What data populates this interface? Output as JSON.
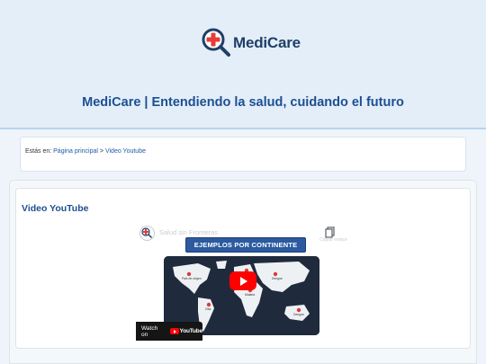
{
  "brand": {
    "name": "MediCare",
    "tagline": "MediCare | Entendiendo la salud, cuidando el futuro"
  },
  "breadcrumb": {
    "prefix": "Estás en:",
    "home": "Página principal",
    "separator": ">",
    "current": "Video Youtube"
  },
  "section": {
    "title": "Video YouTube"
  },
  "video": {
    "title": "Salud sin Fronteras",
    "channel_logo_text": "MediCare",
    "copy_label": "Copiar enlace",
    "banner": "EJEMPLOS POR CONTINENTE",
    "map_labels": [
      "Pais de origen",
      "Mali",
      "Zika",
      "Malaria",
      "Dengue",
      "Dengue"
    ],
    "watch_on": "Watch on",
    "youtube_word": "YouTube",
    "play_icon": "play-icon"
  },
  "colors": {
    "brand_navy": "#1f3f66",
    "accent_blue": "#1d4f91",
    "cross_red": "#e63b3b",
    "header_bg": "#e3eef9",
    "youtube_red": "#ff0000"
  }
}
